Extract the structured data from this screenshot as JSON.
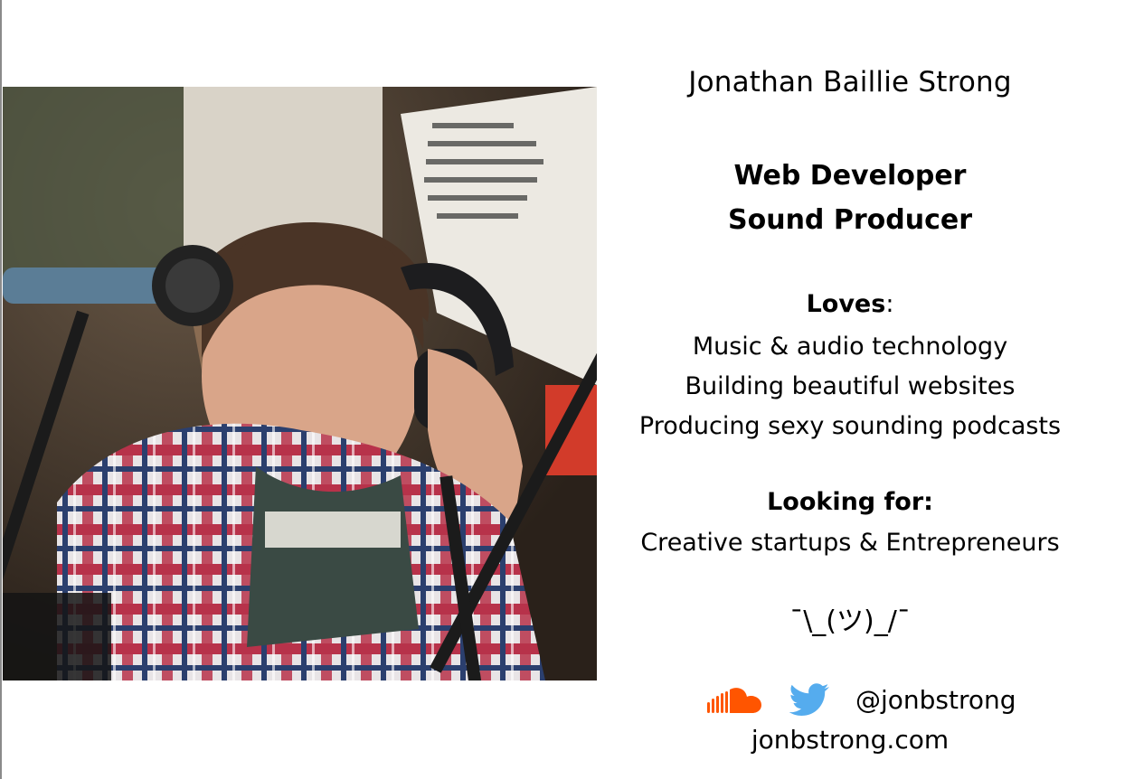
{
  "profile": {
    "name": "Jonathan Baillie Strong",
    "roles": [
      "Web Developer",
      "Sound Producer"
    ],
    "loves": {
      "heading": "Loves",
      "separator": ":",
      "items": [
        "Music & audio technology",
        "Building beautiful websites",
        "Producing sexy sounding podcasts"
      ]
    },
    "looking_for": {
      "heading": "Looking for:",
      "text": "Creative startups & Entrepreneurs"
    },
    "shrug": "¯\\_(ツ)_/¯",
    "social": {
      "icons": [
        "soundcloud-icon",
        "twitter-icon"
      ],
      "handle": "@jonbstrong",
      "website": "jonbstrong.com"
    }
  },
  "colors": {
    "soundcloud": "#ff5500",
    "twitter": "#55acee",
    "text": "#000000",
    "background": "#ffffff"
  }
}
